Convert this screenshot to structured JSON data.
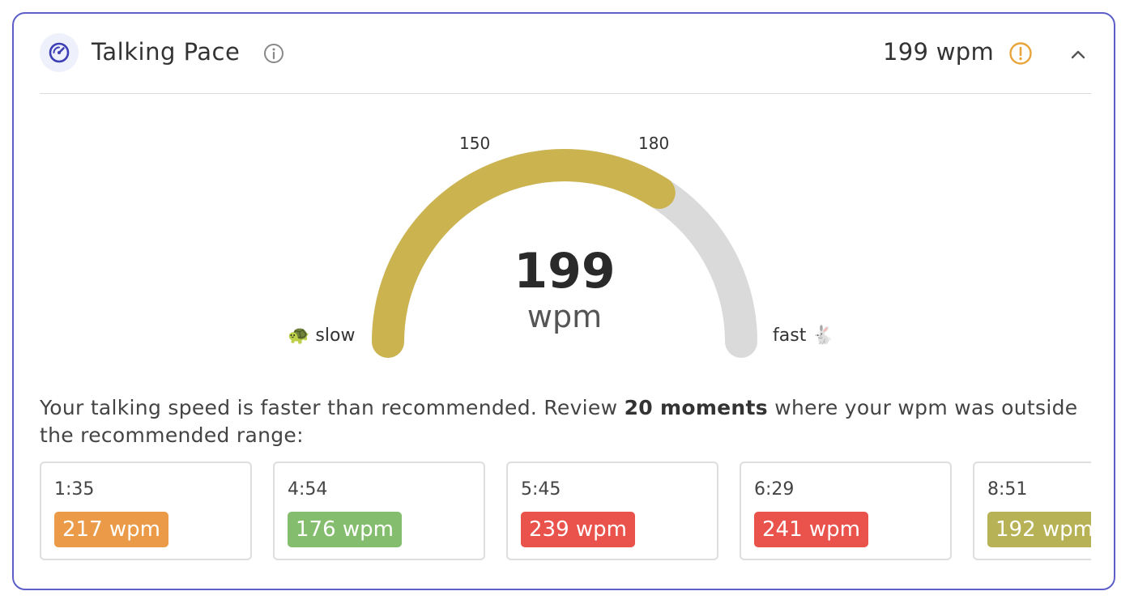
{
  "header": {
    "title": "Talking Pace",
    "value": "199 wpm"
  },
  "gauge": {
    "value": 199,
    "value_text": "199",
    "unit": "wpm",
    "tick_low": "150",
    "tick_high": "180",
    "slow_label": "slow",
    "fast_label": "fast",
    "slow_emoji": "🐢",
    "fast_emoji": "🐇",
    "fill_fraction": 0.68,
    "fill_color": "#cbb450",
    "track_color": "#dadada"
  },
  "summary": {
    "prefix": "Your talking speed is faster than recommended. Review ",
    "bold": "20 moments",
    "suffix": " where your wpm was outside the recommended range:"
  },
  "moments": [
    {
      "time": "1:35",
      "wpm": "217 wpm",
      "color": "#eb9b48"
    },
    {
      "time": "4:54",
      "wpm": "176 wpm",
      "color": "#85bd6e"
    },
    {
      "time": "5:45",
      "wpm": "239 wpm",
      "color": "#e9534c"
    },
    {
      "time": "6:29",
      "wpm": "241 wpm",
      "color": "#e9534c"
    },
    {
      "time": "8:51",
      "wpm": "192 wpm",
      "color": "#b7b256"
    }
  ],
  "colors": {
    "accent": "#5b5fc7",
    "warning": "#e9a43a"
  }
}
